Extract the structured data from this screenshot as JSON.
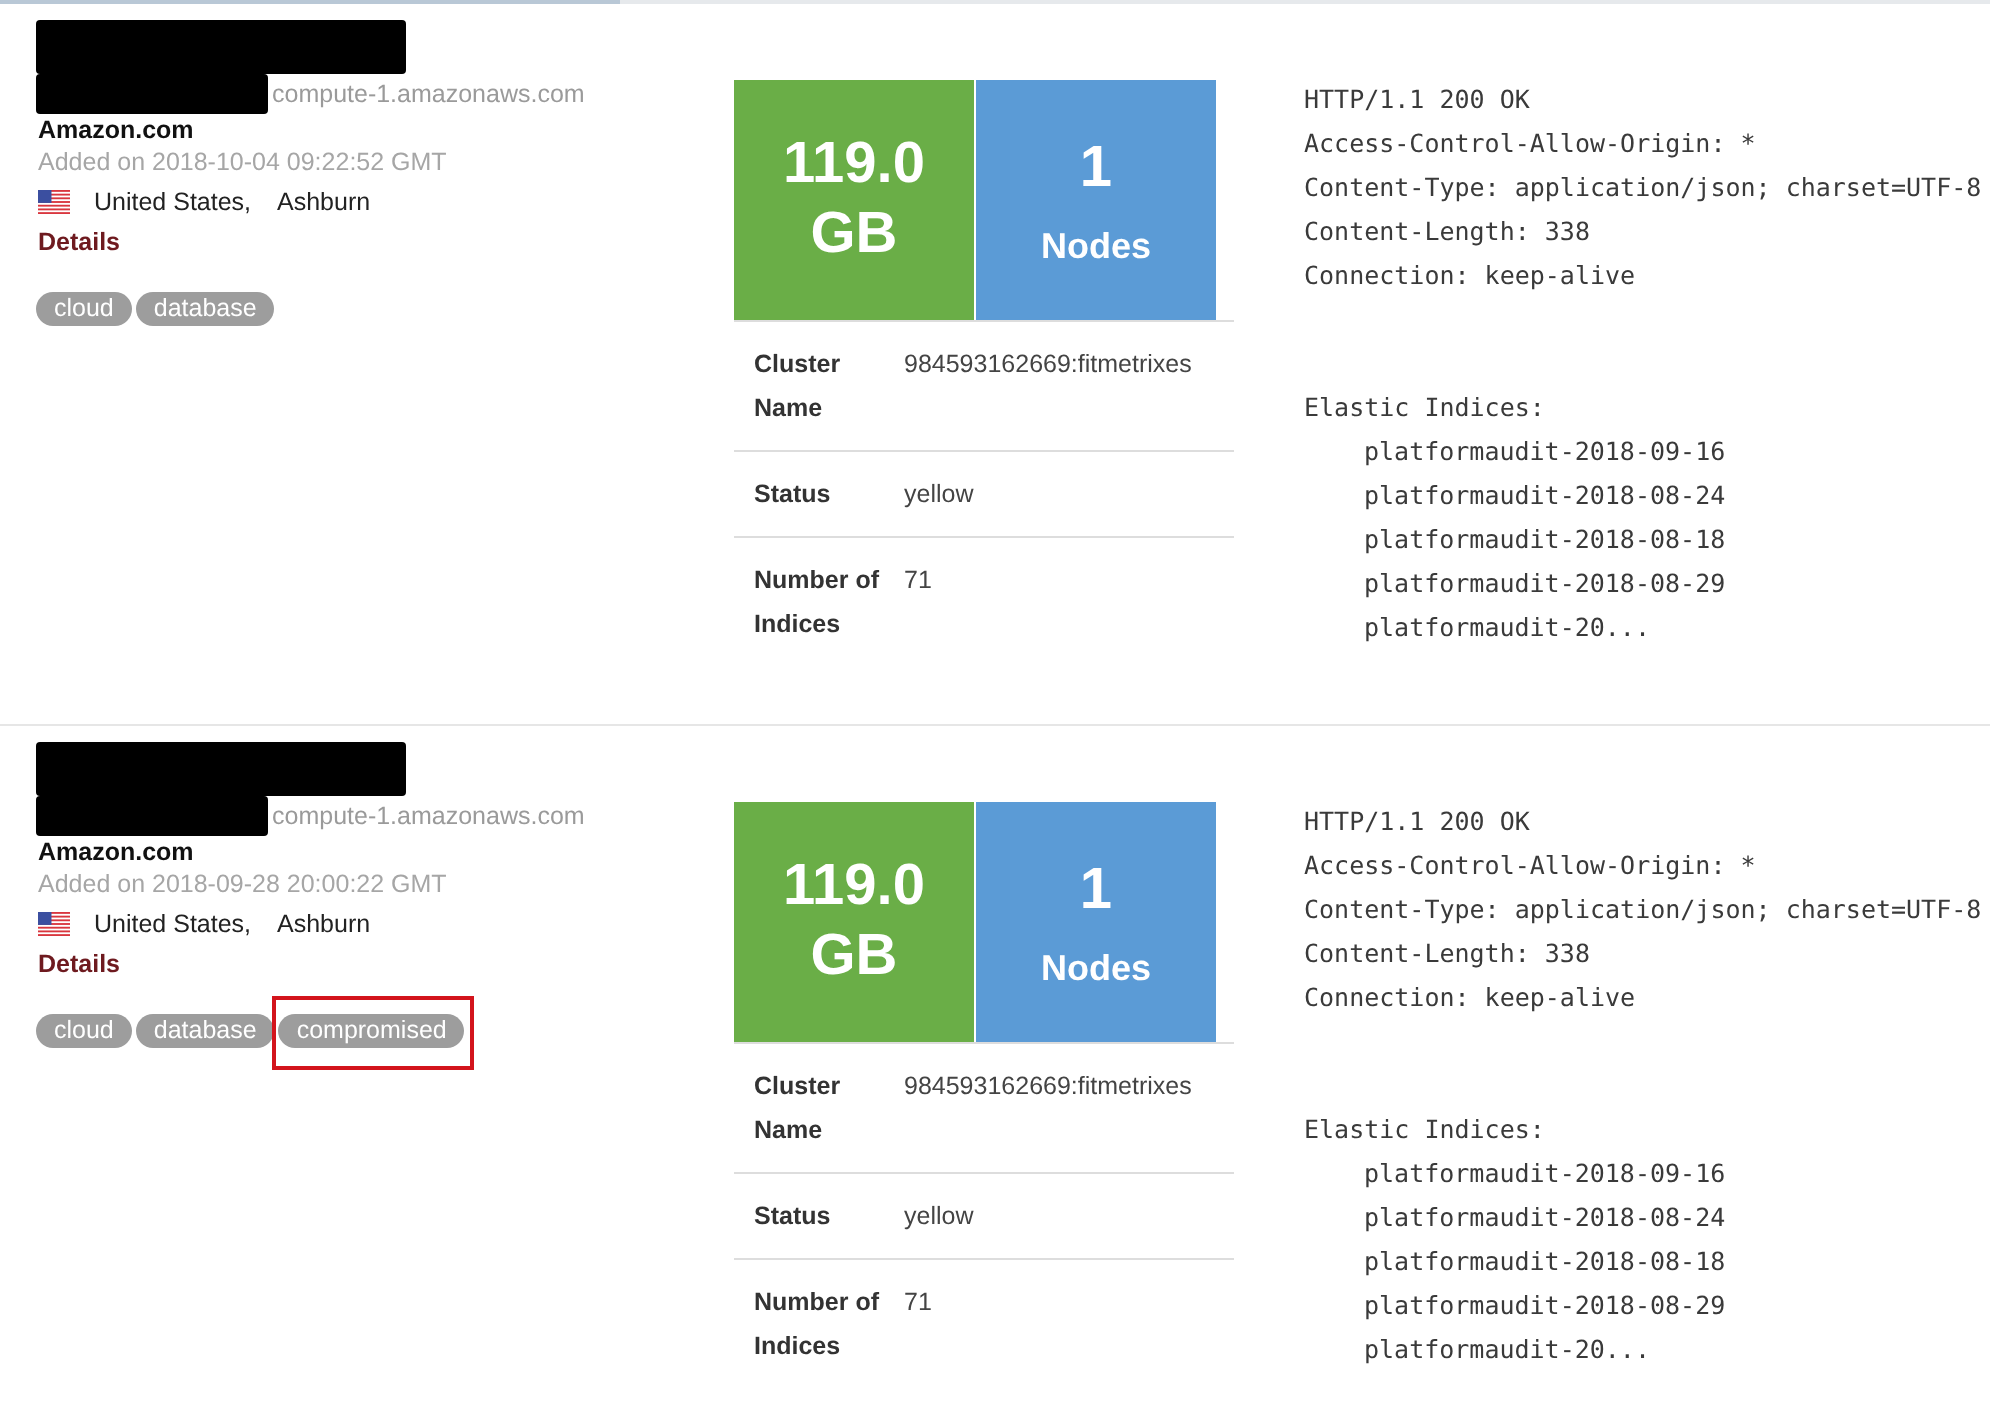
{
  "results": [
    {
      "hostname": "compute-1.amazonaws.com",
      "organization": "Amazon.com",
      "added": "Added on 2018-10-04 09:22:52 GMT",
      "country": "United States,",
      "city": "Ashburn",
      "details_link": "Details",
      "tags": [
        {
          "label": "cloud",
          "highlighted": false
        },
        {
          "label": "database",
          "highlighted": false
        }
      ],
      "stats": [
        {
          "kind": "size",
          "value": "119.0",
          "unit": "GB",
          "color": "#6aae47"
        },
        {
          "kind": "count",
          "value": "1",
          "unit": "Nodes",
          "color": "#5b9bd6"
        }
      ],
      "properties": [
        {
          "label": "Cluster Name",
          "value": "984593162669:fitmetrixes"
        },
        {
          "label": "Status",
          "value": "yellow"
        },
        {
          "label": "Number of Indices",
          "value": "71"
        }
      ],
      "headers": [
        "HTTP/1.1 200 OK",
        "Access-Control-Allow-Origin: *",
        "Content-Type: application/json; charset=UTF-8",
        "Content-Length: 338",
        "Connection: keep-alive"
      ],
      "indices_title": "Elastic Indices:",
      "indices": [
        "platformaudit-2018-09-16",
        "platformaudit-2018-08-24",
        "platformaudit-2018-08-18",
        "platformaudit-2018-08-29",
        "platformaudit-20..."
      ]
    },
    {
      "hostname": "compute-1.amazonaws.com",
      "organization": "Amazon.com",
      "added": "Added on 2018-09-28 20:00:22 GMT",
      "country": "United States,",
      "city": "Ashburn",
      "details_link": "Details",
      "tags": [
        {
          "label": "cloud",
          "highlighted": false
        },
        {
          "label": "database",
          "highlighted": false
        },
        {
          "label": "compromised",
          "highlighted": true
        }
      ],
      "stats": [
        {
          "kind": "size",
          "value": "119.0",
          "unit": "GB",
          "color": "#6aae47"
        },
        {
          "kind": "count",
          "value": "1",
          "unit": "Nodes",
          "color": "#5b9bd6"
        }
      ],
      "properties": [
        {
          "label": "Cluster Name",
          "value": "984593162669:fitmetrixes"
        },
        {
          "label": "Status",
          "value": "yellow"
        },
        {
          "label": "Number of Indices",
          "value": "71"
        }
      ],
      "headers": [
        "HTTP/1.1 200 OK",
        "Access-Control-Allow-Origin: *",
        "Content-Type: application/json; charset=UTF-8",
        "Content-Length: 338",
        "Connection: keep-alive"
      ],
      "indices_title": "Elastic Indices:",
      "indices": [
        "platformaudit-2018-09-16",
        "platformaudit-2018-08-24",
        "platformaudit-2018-08-18",
        "platformaudit-2018-08-29",
        "platformaudit-20..."
      ]
    }
  ]
}
